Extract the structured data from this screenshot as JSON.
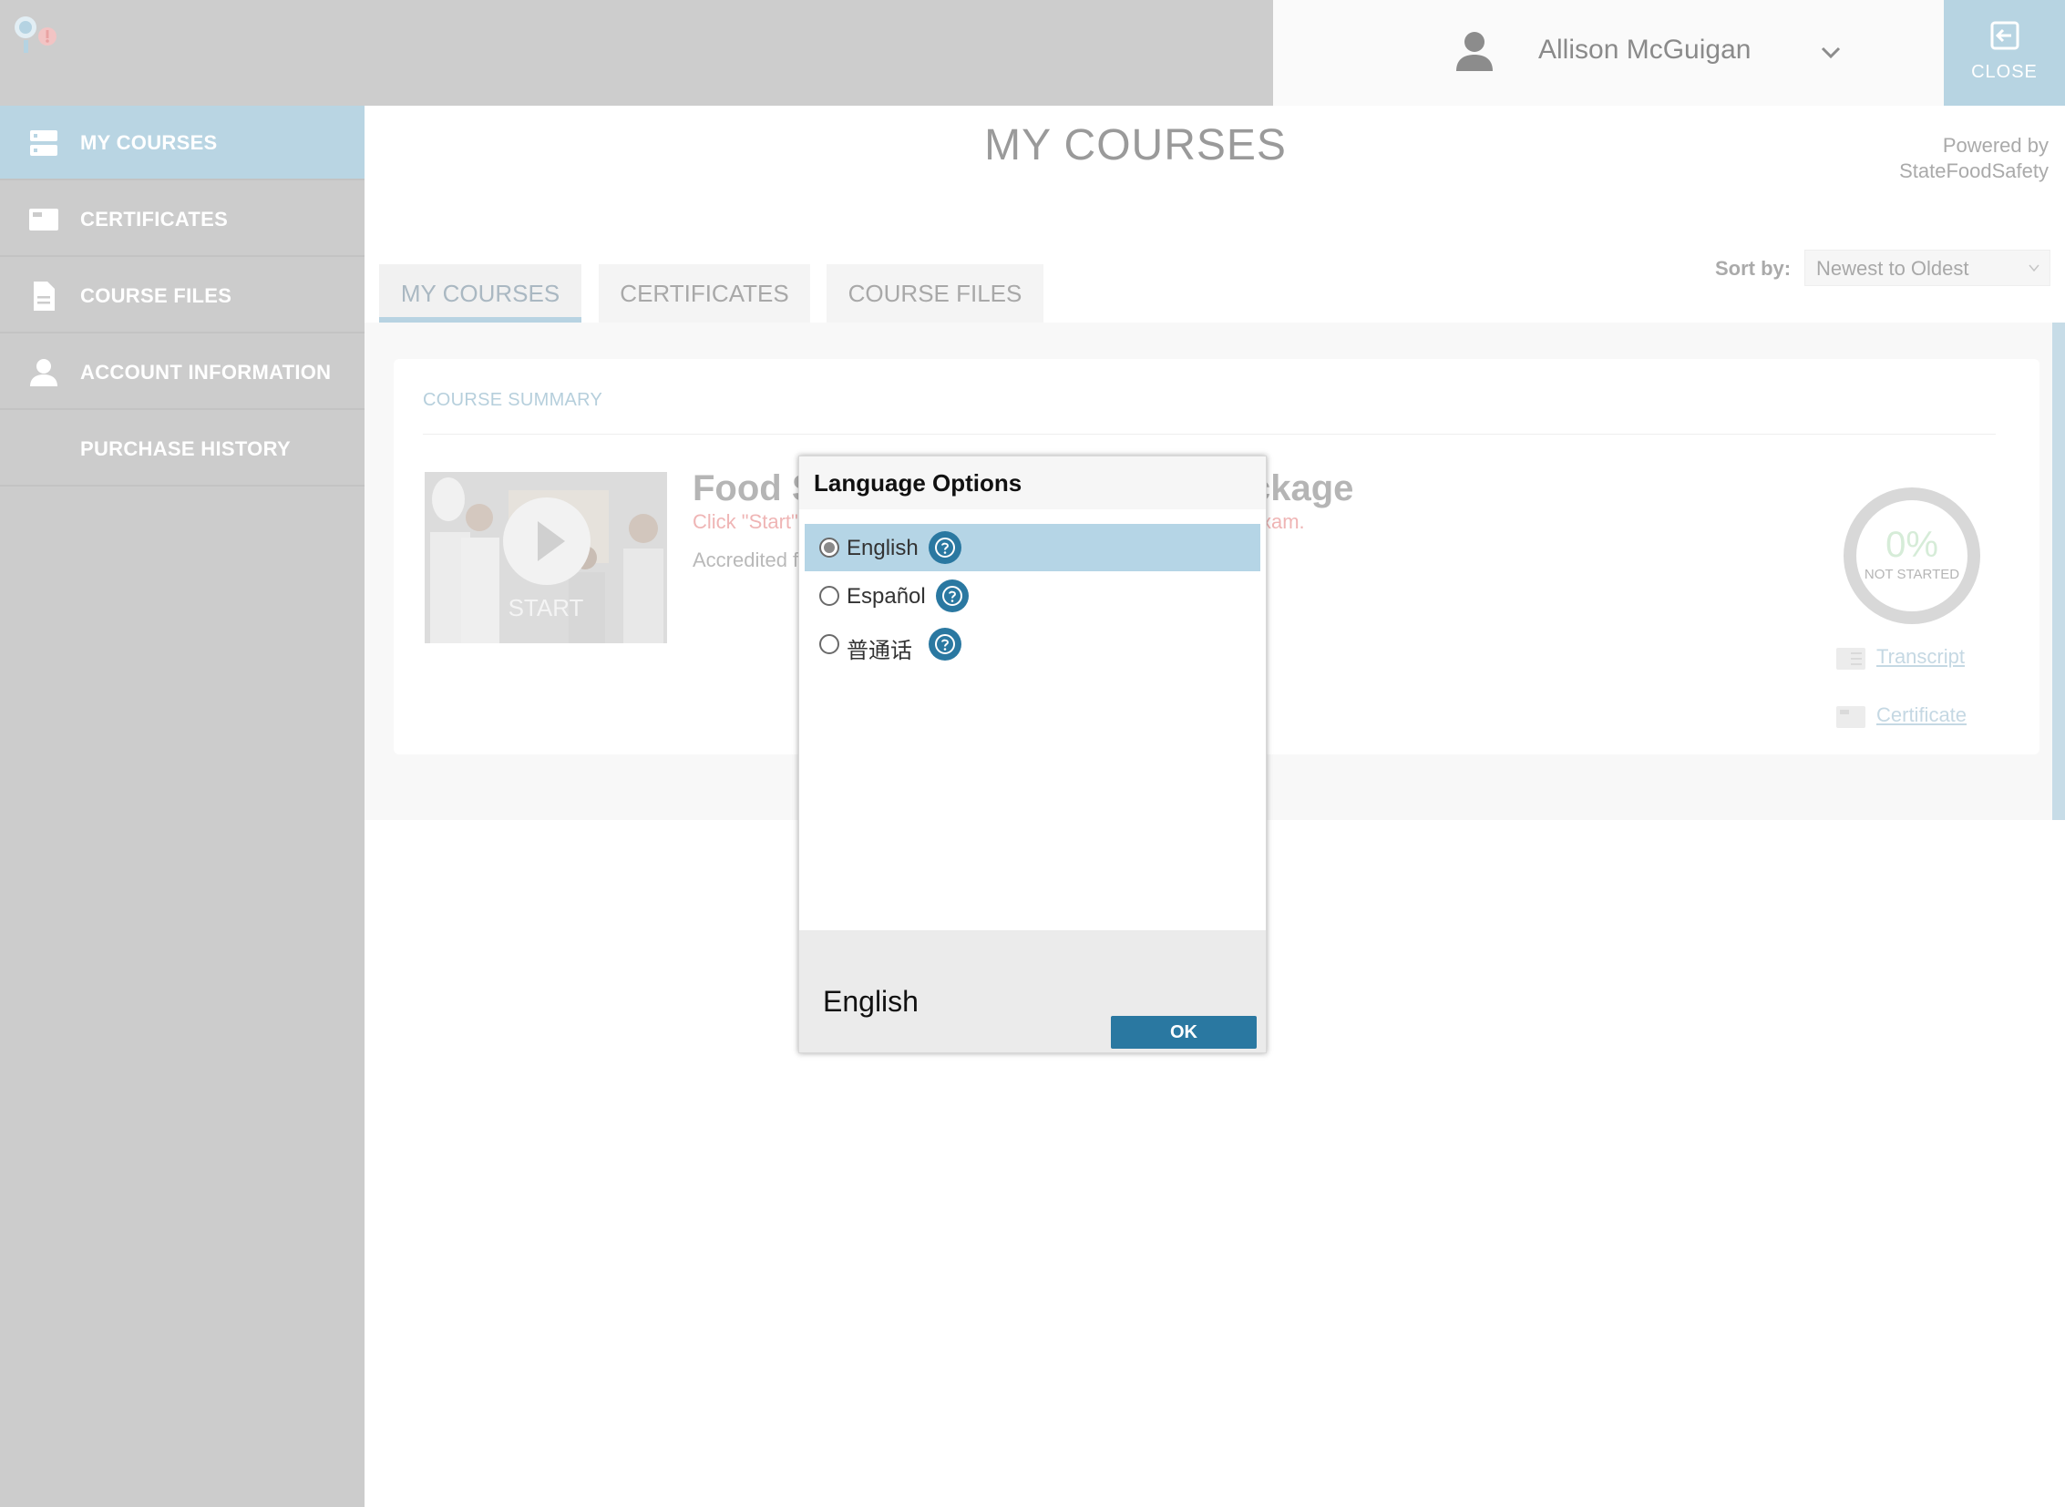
{
  "header": {
    "user_name": "Allison McGuigan",
    "close_label": "CLOSE"
  },
  "sidebar": {
    "items": [
      {
        "label": "MY COURSES",
        "icon": "courses-icon",
        "active": true
      },
      {
        "label": "CERTIFICATES",
        "icon": "certificate-icon",
        "active": false
      },
      {
        "label": "COURSE FILES",
        "icon": "file-icon",
        "active": false
      },
      {
        "label": "ACCOUNT INFORMATION",
        "icon": "person-icon",
        "active": false
      },
      {
        "label": "PURCHASE HISTORY",
        "icon": "",
        "active": false
      }
    ]
  },
  "main": {
    "title": "MY COURSES",
    "powered_by_line1": "Powered by",
    "powered_by_line2": "StateFoodSafety",
    "tabs": [
      {
        "label": "MY COURSES",
        "active": true
      },
      {
        "label": "CERTIFICATES",
        "active": false
      },
      {
        "label": "COURSE FILES",
        "active": false
      }
    ],
    "sort_label": "Sort by:",
    "sort_value": "Newest to Oldest",
    "summary_label": "COURSE SUMMARY",
    "course": {
      "start_label": "START",
      "title_start": "Food S",
      "title_end": "ckage",
      "hint_start": "Click \"Start\"",
      "hint_end": "xam.",
      "accredited": "Accredited f",
      "progress_percent": "0%",
      "progress_fraction": 0,
      "status": "NOT STARTED",
      "transcript_link": "Transcript",
      "certificate_link": "Certificate"
    }
  },
  "dialog": {
    "title": "Language Options",
    "options": [
      {
        "label": "English",
        "selected": true
      },
      {
        "label": "Español",
        "selected": false
      },
      {
        "label": "普通话",
        "selected": false
      }
    ],
    "current_value": "English",
    "ok_label": "OK"
  },
  "colors": {
    "accent": "#2a78a1",
    "selection": "#b5d5e6",
    "sidebar_active": "#b9d5e3"
  }
}
